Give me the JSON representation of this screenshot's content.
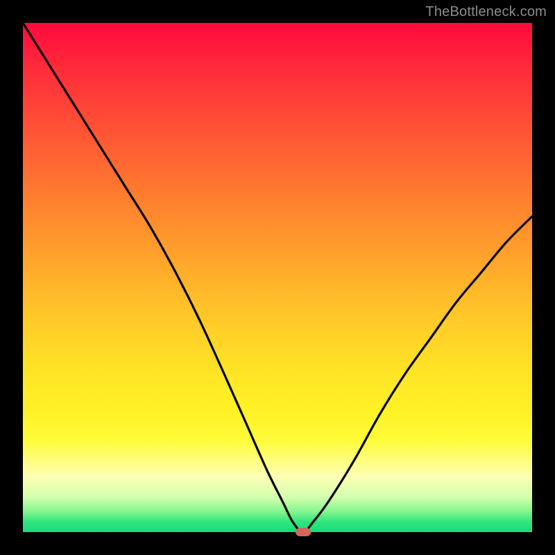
{
  "watermark": "TheBottleneck.com",
  "colors": {
    "curve": "#000000",
    "marker": "#cc6a5c",
    "frame": "#000000"
  },
  "chart_data": {
    "type": "line",
    "title": "",
    "xlabel": "",
    "ylabel": "",
    "xlim": [
      0,
      100
    ],
    "ylim": [
      0,
      100
    ],
    "grid": false,
    "legend": false,
    "annotations": [
      {
        "kind": "marker",
        "x": 55,
        "y": 0,
        "shape": "rounded-rect"
      }
    ],
    "series": [
      {
        "name": "bottleneck-curve",
        "x": [
          0,
          5,
          10,
          15,
          20,
          25,
          30,
          35,
          40,
          44,
          48,
          51,
          53,
          55,
          57,
          60,
          65,
          70,
          75,
          80,
          85,
          90,
          95,
          100
        ],
        "values": [
          100,
          92,
          84,
          76,
          68,
          60,
          51,
          41,
          30,
          21,
          12,
          6,
          2,
          0,
          2,
          6,
          14,
          23,
          31,
          38,
          45,
          51,
          57,
          62
        ]
      }
    ]
  }
}
